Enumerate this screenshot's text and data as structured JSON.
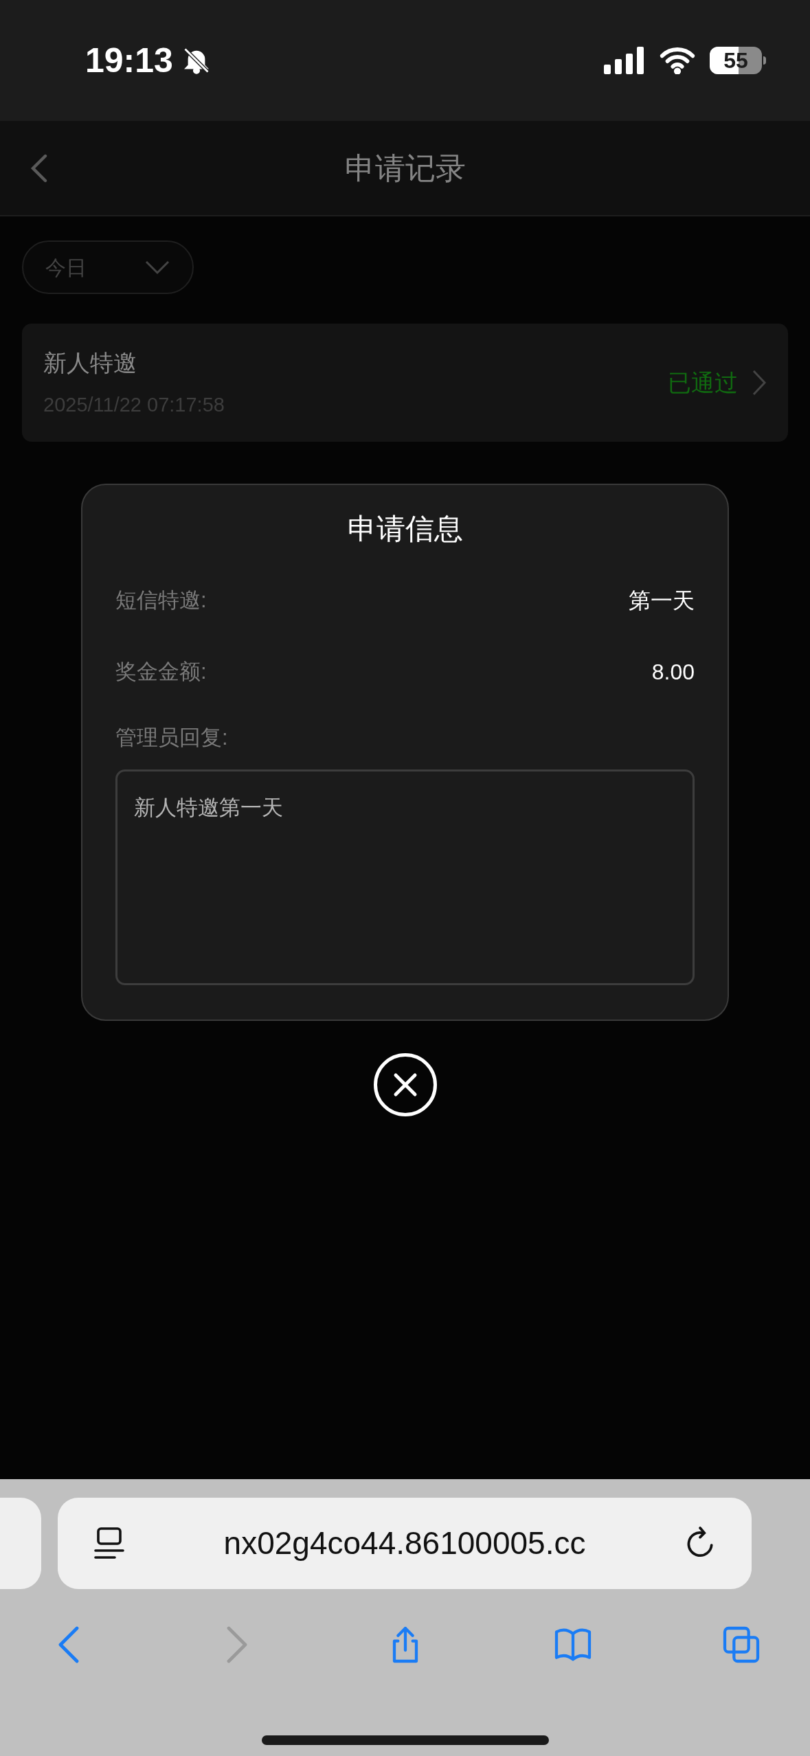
{
  "status_bar": {
    "time": "19:13",
    "battery": "55"
  },
  "header": {
    "title": "申请记录"
  },
  "filter": {
    "value": "今日"
  },
  "records": [
    {
      "title": "新人特邀",
      "date": "2025/11/22 07:17:58",
      "status": "已通过"
    }
  ],
  "dialog": {
    "title": "申请信息",
    "fields": [
      {
        "label": "短信特邀:",
        "value": "第一天"
      },
      {
        "label": "奖金金额:",
        "value": "8.00"
      }
    ],
    "reply_label": "管理员回复:",
    "reply_text": "新人特邀第一天"
  },
  "browser": {
    "url": "nx02g4co44.86100005.cc",
    "toolbar": [
      {
        "kind": "back",
        "disabled": false
      },
      {
        "kind": "forward",
        "disabled": true
      },
      {
        "kind": "share",
        "disabled": false
      },
      {
        "kind": "bookmarks",
        "disabled": false
      },
      {
        "kind": "tabs",
        "disabled": false
      }
    ]
  }
}
